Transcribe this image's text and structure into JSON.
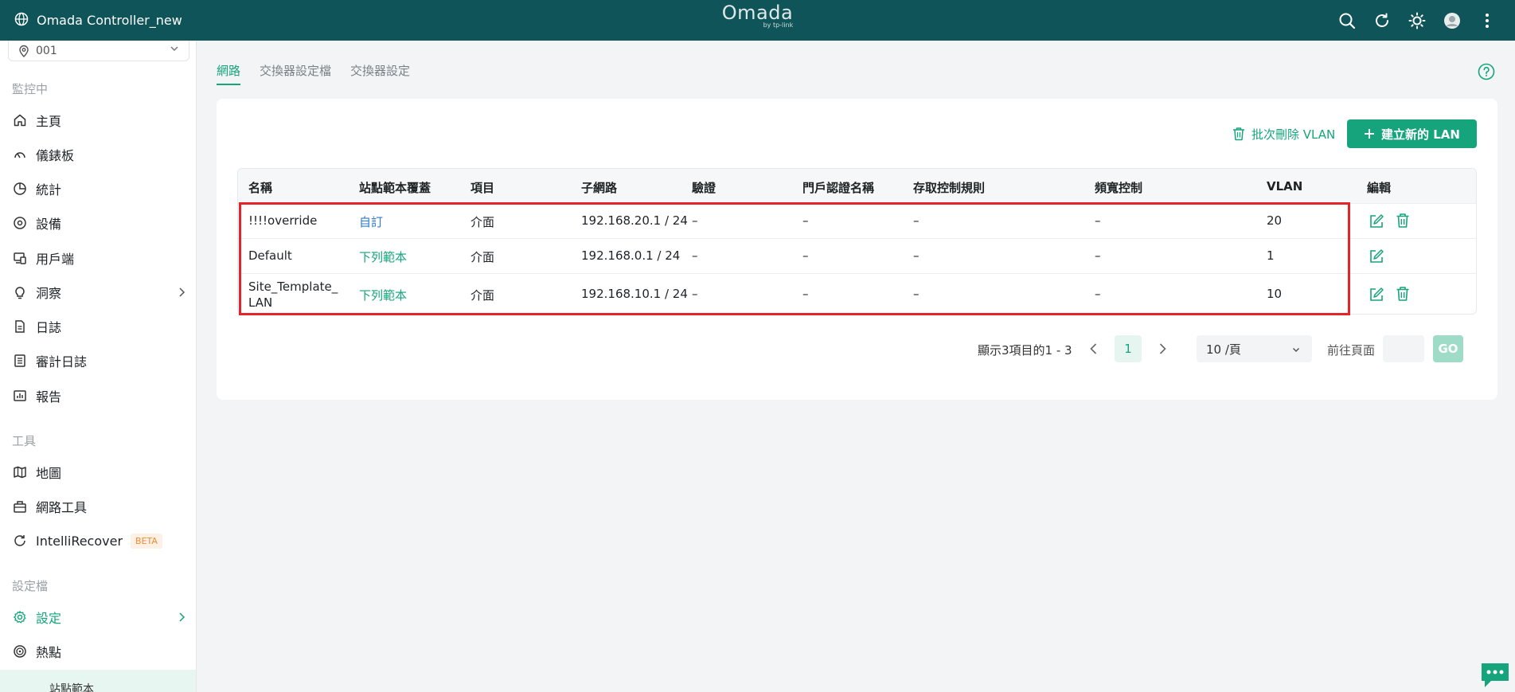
{
  "app": {
    "title": "Omada Controller_new",
    "logo": "Omada",
    "logo_sub": "by tp-link"
  },
  "topbar": {
    "icons": [
      "search-icon",
      "refresh-icon",
      "theme-icon",
      "avatar",
      "more-icon"
    ]
  },
  "sidebar": {
    "site": "001",
    "sections": {
      "monitor": "監控中",
      "tools": "工具",
      "config": "設定檔"
    },
    "items": [
      {
        "label": "主頁",
        "icon": "home-icon"
      },
      {
        "label": "儀錶板",
        "icon": "dashboard-icon"
      },
      {
        "label": "統計",
        "icon": "pie-chart-icon"
      },
      {
        "label": "設備",
        "icon": "device-icon"
      },
      {
        "label": "用戶端",
        "icon": "client-icon"
      },
      {
        "label": "洞察",
        "icon": "bulb-icon"
      },
      {
        "label": "日誌",
        "icon": "log-icon"
      },
      {
        "label": "審計日誌",
        "icon": "audit-log-icon"
      },
      {
        "label": "報告",
        "icon": "report-icon"
      },
      {
        "label": "地圖",
        "icon": "map-icon"
      },
      {
        "label": "網路工具",
        "icon": "toolbox-icon"
      },
      {
        "label": "IntelliRecover",
        "icon": "recover-icon",
        "badge": "BETA"
      },
      {
        "label": "設定",
        "icon": "gear-icon"
      },
      {
        "label": "熱點",
        "icon": "hotspot-icon"
      }
    ],
    "bottom_label": "站點範本"
  },
  "tabs": [
    "網路",
    "交換器設定檔",
    "交換器設定"
  ],
  "toolbar": {
    "batch_delete": "批次刪除 VLAN",
    "create_new": "建立新的 LAN"
  },
  "table": {
    "columns": [
      "名稱",
      "站點範本覆蓋",
      "項目",
      "子網路",
      "驗證",
      "門戶認證名稱",
      "存取控制規則",
      "頻寬控制",
      "VLAN",
      "編輯"
    ],
    "rows": [
      {
        "name": "!!!!override",
        "override": "自訂",
        "override_color": "#2b7bd6",
        "purpose": "介面",
        "subnet": "192.168.20.1 / 24",
        "auth": "–",
        "portal": "–",
        "acl": "–",
        "bandwidth": "–",
        "vlan": "20",
        "deletable": true
      },
      {
        "name": "Default",
        "override": "下列範本",
        "override_color": "#15a47c",
        "purpose": "介面",
        "subnet": "192.168.0.1 / 24",
        "auth": "–",
        "portal": "–",
        "acl": "–",
        "bandwidth": "–",
        "vlan": "1",
        "deletable": false
      },
      {
        "name": "Site_Template_LAN",
        "name_line1": "Site_Template_",
        "name_line2": "LAN",
        "override": "下列範本",
        "override_color": "#15a47c",
        "purpose": "介面",
        "subnet": "192.168.10.1 / 24",
        "auth": "–",
        "portal": "–",
        "acl": "–",
        "bandwidth": "–",
        "vlan": "10",
        "deletable": true
      }
    ]
  },
  "pagination": {
    "info": "顯示3項目的1 - 3",
    "current_page": "1",
    "page_size": "10 /頁",
    "goto_label": "前往頁面",
    "go": "GO"
  },
  "colors": {
    "topbar": "#0e5458",
    "accent": "#15a47c",
    "highlight": "#e3242b"
  }
}
